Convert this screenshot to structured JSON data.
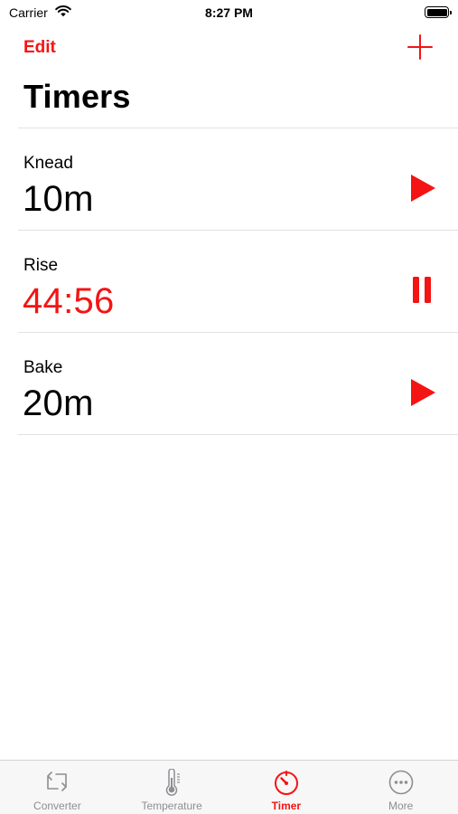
{
  "status_bar": {
    "carrier": "Carrier",
    "time": "8:27 PM"
  },
  "nav": {
    "edit_label": "Edit",
    "add_icon": "plus-icon"
  },
  "page_title": "Timers",
  "timers": [
    {
      "name": "Knead",
      "value": "10m",
      "running": false,
      "icon": "play-icon"
    },
    {
      "name": "Rise",
      "value": "44:56",
      "running": true,
      "icon": "pause-icon"
    },
    {
      "name": "Bake",
      "value": "20m",
      "running": false,
      "icon": "play-icon"
    }
  ],
  "tabs": [
    {
      "label": "Converter",
      "icon": "converter-icon",
      "selected": false
    },
    {
      "label": "Temperature",
      "icon": "thermometer-icon",
      "selected": false
    },
    {
      "label": "Timer",
      "icon": "timer-icon",
      "selected": true
    },
    {
      "label": "More",
      "icon": "more-icon",
      "selected": false
    }
  ],
  "colors": {
    "accent": "#f41414",
    "inactive_tab": "#8e8e93",
    "divider": "#e1e1e4",
    "tab_bar_bg": "#f7f7f7"
  }
}
